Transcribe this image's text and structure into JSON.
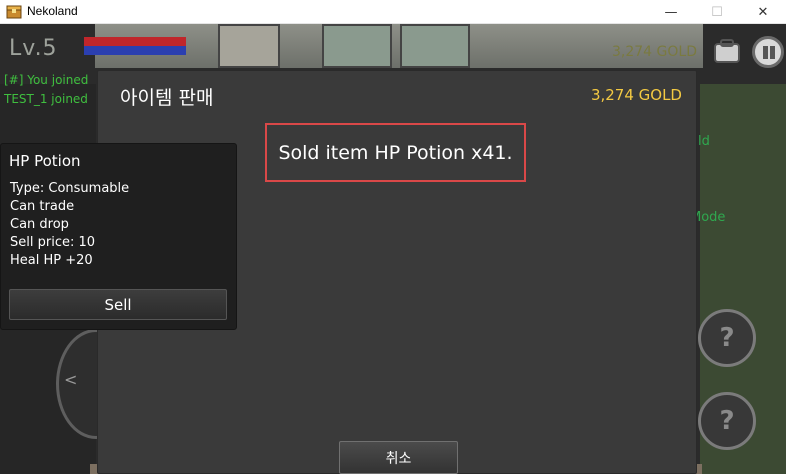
{
  "window": {
    "title": "Nekoland",
    "minimize_glyph": "—",
    "maximize_glyph": "☐",
    "close_glyph": "✕"
  },
  "hud": {
    "level": "Lv.5",
    "gold": "3,274 GOLD",
    "chat": [
      "[#] You joined",
      "TEST_1 joined"
    ],
    "side_texts": [
      "ld",
      "Mode"
    ],
    "question_glyph": "?",
    "dpad_arrow": "<"
  },
  "dialog": {
    "title": "아이템 판매",
    "gold": "3,274 GOLD",
    "message": "Sold item HP Potion x41.",
    "cancel_label": "취소"
  },
  "item": {
    "name": "HP Potion",
    "properties": [
      "Type: Consumable",
      "Can trade",
      "Can drop",
      "Sell price: 10",
      "Heal HP +20"
    ],
    "sell_label": "Sell"
  },
  "colors": {
    "gold": "#f3c942",
    "highlight_border": "#d94848",
    "chat_green": "#3fbf3f",
    "dialog_bg": "#3a3a3a"
  }
}
